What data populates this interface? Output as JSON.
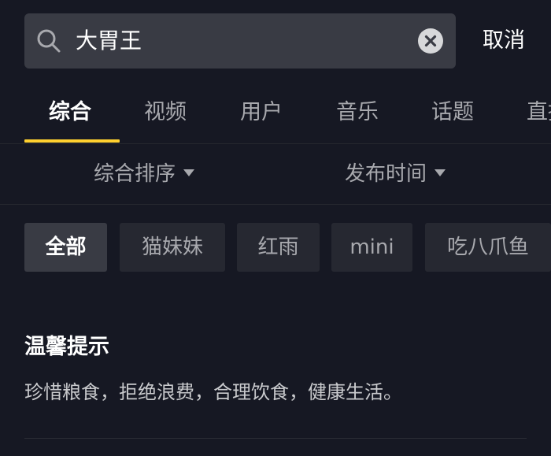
{
  "search": {
    "query": "大胃王",
    "cancel_label": "取消",
    "search_icon": "search-icon",
    "clear_icon": "clear-icon"
  },
  "tabs": [
    {
      "label": "综合",
      "active": true
    },
    {
      "label": "视频",
      "active": false
    },
    {
      "label": "用户",
      "active": false
    },
    {
      "label": "音乐",
      "active": false
    },
    {
      "label": "话题",
      "active": false
    },
    {
      "label": "直播",
      "active": false
    }
  ],
  "sort": {
    "order_label": "综合排序",
    "time_label": "发布时间"
  },
  "chips": [
    {
      "label": "全部",
      "active": true
    },
    {
      "label": "猫妹妹",
      "active": false
    },
    {
      "label": "红雨",
      "active": false
    },
    {
      "label": "mini",
      "active": false
    },
    {
      "label": "吃八爪鱼",
      "active": false
    }
  ],
  "tip": {
    "title": "温馨提示",
    "body": "珍惜粮食，拒绝浪费，合理饮食，健康生活。"
  },
  "colors": {
    "background": "#161823",
    "accent": "#ffd02f",
    "search_bg": "#393b44",
    "chip_bg": "#262831"
  }
}
